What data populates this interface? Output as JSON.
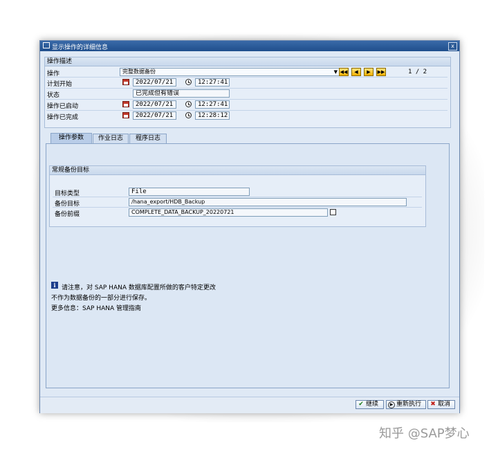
{
  "window": {
    "title": "显示操作的详细信息",
    "close_glyph": "x"
  },
  "op_desc": {
    "header": "操作描述",
    "operation_label": "操作",
    "operation_value": "完整数据备份",
    "planned_start_label": "计划开始",
    "planned_start_date": "2022/07/21",
    "planned_start_time": "12:27:41",
    "status_label": "状态",
    "status_value": "已完成但有错误",
    "started_label": "操作已启动",
    "started_date": "2022/07/21",
    "started_time": "12:27:41",
    "finished_label": "操作已完成",
    "finished_date": "2022/07/21",
    "finished_time": "12:28:12",
    "page_indicator": "1 / 2"
  },
  "tabs": [
    {
      "label": "操作参数"
    },
    {
      "label": "作业日志"
    },
    {
      "label": "程序日志"
    }
  ],
  "backup_target": {
    "header": "常规备份目标",
    "type_label": "目标类型",
    "type_value": "File",
    "target_label": "备份目标",
    "target_value": "/hana_export/HDB_Backup",
    "prefix_label": "备份前缀",
    "prefix_value": "COMPLETE_DATA_BACKUP_20220721"
  },
  "notice": {
    "line1": "请注意，对 SAP HANA 数据库配置所做的客户特定更改",
    "line2": "不作为数据备份的一部分进行保存。",
    "line3": "更多信息：SAP HANA 管理指南"
  },
  "buttons": {
    "continue": "继续",
    "rerun": "重新执行",
    "cancel": "取消"
  },
  "watermark": "知乎 @SAP梦心",
  "colors": {
    "title_bar": "#1f4e8c",
    "background": "#dfe9f5",
    "nav_button": "#f2b100"
  }
}
